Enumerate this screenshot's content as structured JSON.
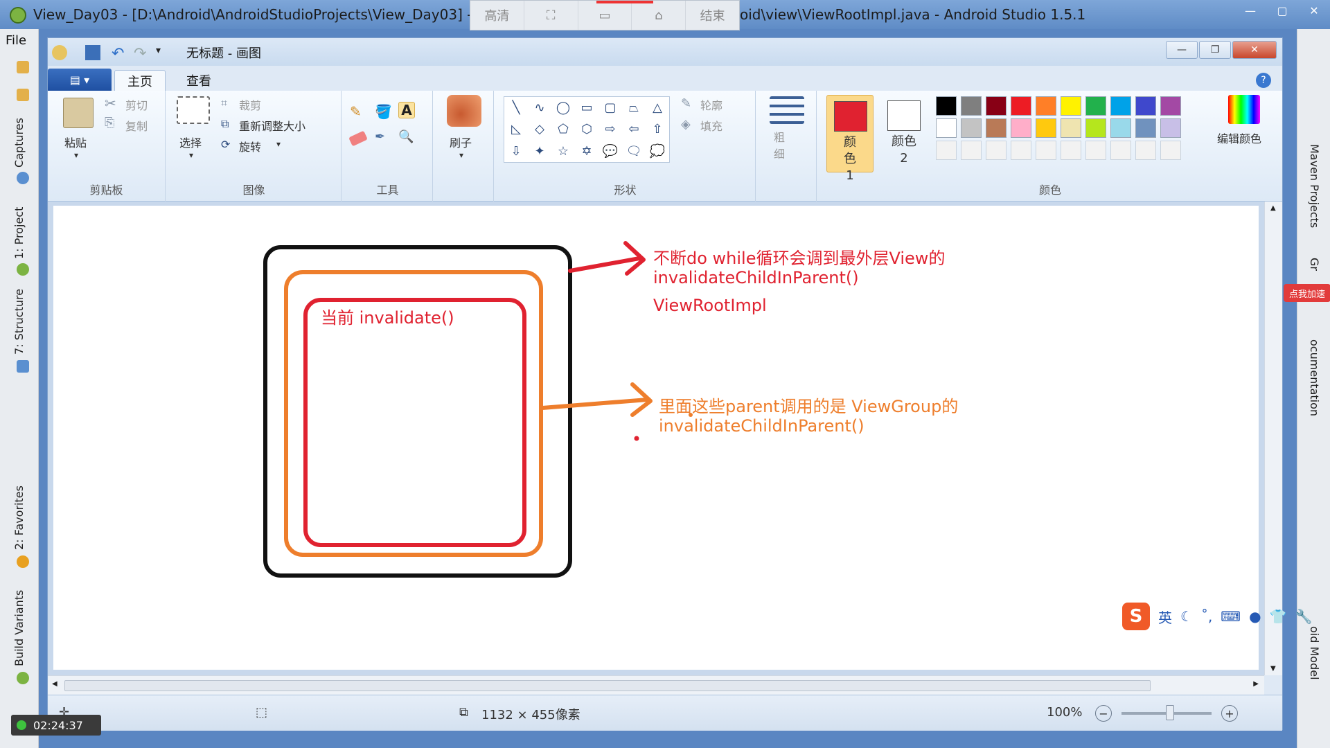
{
  "android_studio": {
    "title_left": "View_Day03 - [D:\\Android\\AndroidStudioProjects\\View_Day03] - [",
    "title_right": "oid\\view\\ViewRootImpl.java - Android Studio 1.5.1",
    "menu_file": "File",
    "left_tabs": [
      "Captures",
      "1: Project",
      "7: Structure",
      "2: Favorites",
      "Build Variants"
    ],
    "right_tabs": [
      "Maven Projects",
      "Gr",
      "ocumentation",
      "oid Model"
    ],
    "side_badge": "点我加速"
  },
  "recorder": {
    "buttons": [
      "高清",
      "⛶",
      "▭",
      "⌂",
      "结束"
    ],
    "timer": "02:24:37"
  },
  "paint": {
    "title": "无标题 - 画图",
    "tabs": [
      "主页",
      "查看"
    ],
    "menu_button": "▤ ▾",
    "ribbon": {
      "clipboard": {
        "paste": "粘贴",
        "cut": "剪切",
        "copy": "复制",
        "label": "剪贴板"
      },
      "image": {
        "select": "选择",
        "crop": "裁剪",
        "resize": "重新调整大小",
        "rotate": "旋转",
        "label": "图像"
      },
      "tools": {
        "label": "工具"
      },
      "brush": {
        "label": "刷子"
      },
      "shapes": {
        "outline": "轮廓",
        "fill": "填充",
        "label": "形状",
        "items": [
          "╲",
          "∿",
          "◯",
          "▭",
          "▢",
          "⏢",
          "△",
          "◺",
          "◇",
          "⬠",
          "⬡",
          "⇨",
          "⇦",
          "⇧",
          "⇩",
          "✦",
          "☆",
          "✡",
          "💬",
          "🗨",
          "💭"
        ]
      },
      "size": {
        "label": "粗细"
      },
      "color1": {
        "label": "颜色 1",
        "value": "#e02230"
      },
      "color2": {
        "label": "颜色 2",
        "value": "#ffffff"
      },
      "edit_colors": "编辑颜色",
      "colors_label": "颜色",
      "palette_row1": [
        "#000000",
        "#7f7f7f",
        "#880015",
        "#ed1c24",
        "#ff7f27",
        "#fff200",
        "#22b14c",
        "#00a2e8",
        "#3f48cc",
        "#a349a4"
      ],
      "palette_row2": [
        "#ffffff",
        "#c3c3c3",
        "#b97a57",
        "#ffaec9",
        "#ffc90e",
        "#efe4b0",
        "#b5e61d",
        "#99d9ea",
        "#7092be",
        "#c8bfe7"
      ]
    },
    "canvas": {
      "inner_label": "当前  invalidate()",
      "note_red_1": "不断do while循环会调到最外层View的",
      "note_red_2": "invalidateChildInParent()",
      "note_red_3": "ViewRootImpl",
      "note_orange_1": "里面这些parent调用的是 ViewGroup的",
      "note_orange_2": "invalidateChildInParent()"
    },
    "status": {
      "size": "1132 × 455像素",
      "zoom": "100%"
    }
  },
  "ime": {
    "lang": "英"
  }
}
